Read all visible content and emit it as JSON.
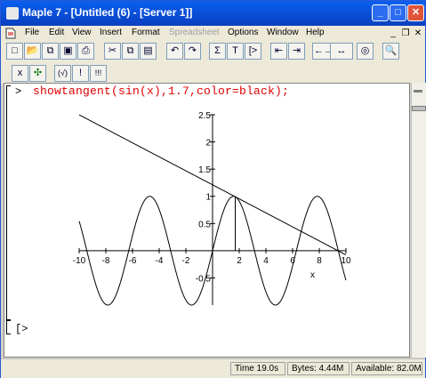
{
  "window": {
    "title": "Maple 7  - [Untitled (6) - [Server 1]]",
    "min_label": "_",
    "max_label": "□",
    "close_label": "✕"
  },
  "menu": {
    "items": [
      {
        "label": "File",
        "enabled": true
      },
      {
        "label": "Edit",
        "enabled": true
      },
      {
        "label": "View",
        "enabled": true
      },
      {
        "label": "Insert",
        "enabled": true
      },
      {
        "label": "Format",
        "enabled": true
      },
      {
        "label": "Spreadsheet",
        "enabled": false
      },
      {
        "label": "Options",
        "enabled": true
      },
      {
        "label": "Window",
        "enabled": true
      },
      {
        "label": "Help",
        "enabled": true
      }
    ],
    "mdi_min": "_",
    "mdi_restore": "❐",
    "mdi_close": "✕"
  },
  "toolbar": {
    "buttons": [
      {
        "name": "new-icon",
        "glyph": "□"
      },
      {
        "name": "open-icon",
        "glyph": "📂"
      },
      {
        "name": "open-url-icon",
        "glyph": "⧉"
      },
      {
        "name": "save-icon",
        "glyph": "▣"
      },
      {
        "name": "print-icon",
        "glyph": "⎙"
      },
      {
        "name": "cut-icon",
        "glyph": "✂"
      },
      {
        "name": "copy-icon",
        "glyph": "⧉"
      },
      {
        "name": "paste-icon",
        "glyph": "▤"
      },
      {
        "name": "undo-icon",
        "glyph": "↶"
      },
      {
        "name": "redo-icon",
        "glyph": "↷"
      },
      {
        "name": "sigma-icon",
        "glyph": "Σ"
      },
      {
        "name": "text-mode-icon",
        "glyph": "T"
      },
      {
        "name": "input-mode-icon",
        "glyph": "[>"
      },
      {
        "name": "indent-left-icon",
        "glyph": "⇤"
      },
      {
        "name": "indent-right-icon",
        "glyph": "⇥"
      },
      {
        "name": "collapse-icon",
        "glyph": "←→"
      },
      {
        "name": "expand-icon",
        "glyph": "↔"
      },
      {
        "name": "stop-icon",
        "glyph": "◎"
      },
      {
        "name": "zoom-icon",
        "glyph": "🔍"
      }
    ],
    "row2": [
      {
        "name": "math-mode-icon",
        "glyph": "x"
      },
      {
        "name": "palette-icon",
        "glyph": "✣"
      },
      {
        "name": "execute-region-icon",
        "glyph": "(√)"
      },
      {
        "name": "execute-icon",
        "glyph": "!"
      },
      {
        "name": "execute-all-icon",
        "glyph": "!!!"
      }
    ]
  },
  "worksheet": {
    "prompt": ">",
    "command": "showtangent(sin(x),1.7,color=black);",
    "empty_prompt": "[>"
  },
  "chart_data": {
    "type": "line",
    "title": "",
    "xlabel": "x",
    "ylabel": "",
    "xlim": [
      -10,
      10
    ],
    "ylim": [
      -1,
      2.5
    ],
    "x_ticks": [
      "-10",
      "-8",
      "-6",
      "-4",
      "-2",
      "2",
      "4",
      "6",
      "8",
      "10"
    ],
    "x_tick_values": [
      -10,
      -8,
      -6,
      -4,
      -2,
      2,
      4,
      6,
      8,
      10
    ],
    "y_ticks": [
      "-0.5",
      "0.5",
      "1",
      "1.5",
      "2",
      "2.5"
    ],
    "y_tick_values": [
      -0.5,
      0.5,
      1,
      1.5,
      2,
      2.5
    ],
    "y_tick_labels_shown": [
      "-0.5",
      "0.5",
      "1",
      "1.5",
      "2",
      "2.5"
    ],
    "series": [
      {
        "function": "sin(x)",
        "x_range": [
          -10,
          10
        ]
      },
      {
        "function": "tangent at x=1.7",
        "x_range": [
          -10,
          10
        ],
        "point_x": 1.7
      }
    ],
    "color": "#000000",
    "grid": false
  },
  "status": {
    "time": "Time  19.0s",
    "bytes": "Bytes: 4.44M",
    "available": "Available: 82.0M"
  }
}
